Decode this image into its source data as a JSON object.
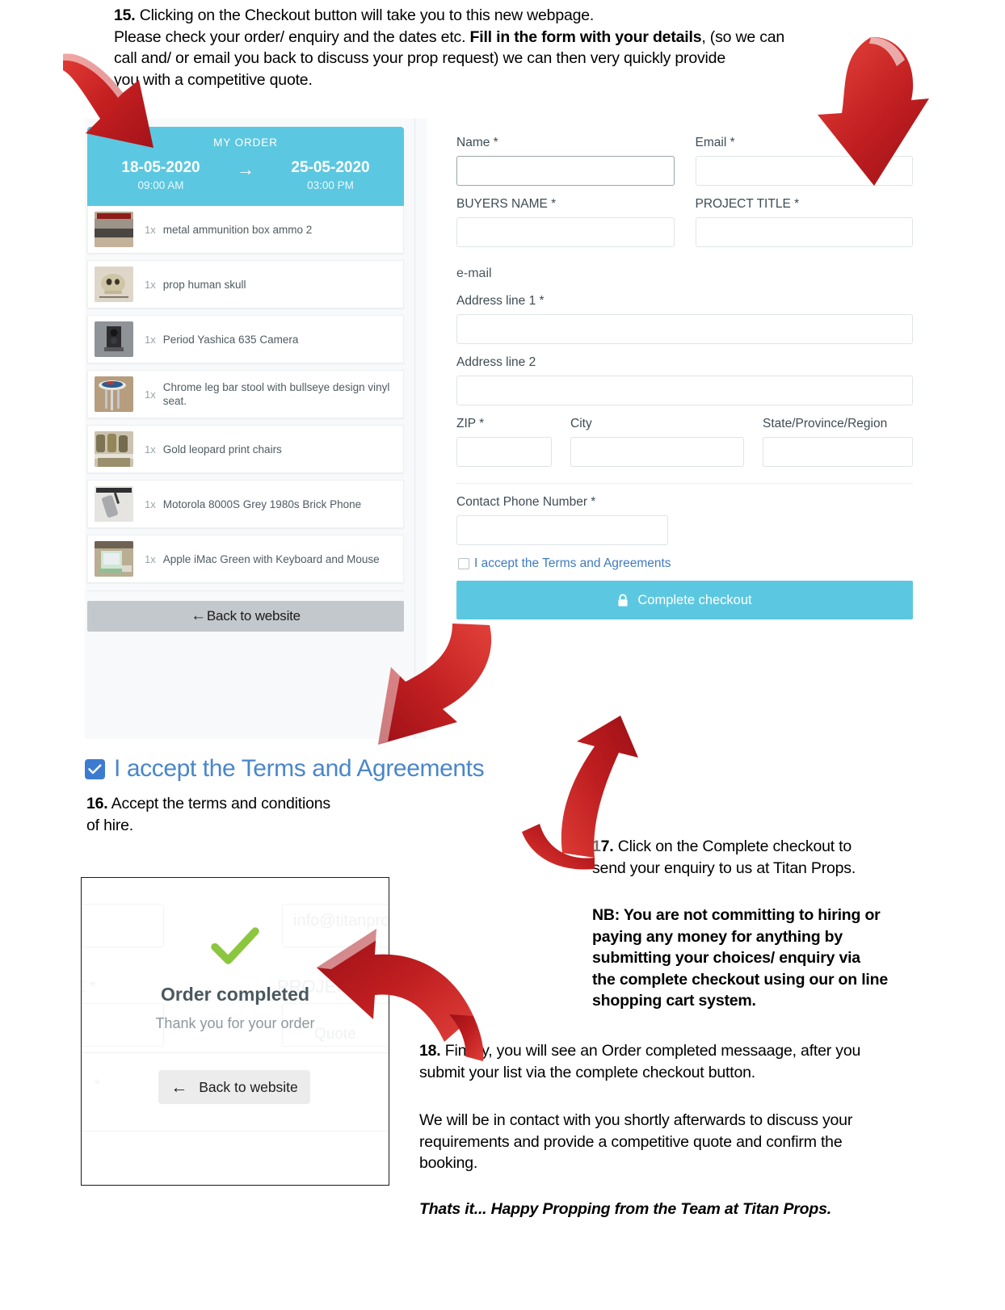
{
  "top_instructions": {
    "line1_num": "15.",
    "line1": " Clicking on the Checkout button will take you to this new webpage.",
    "line2a": "Please check your order/ enquiry and the dates etc. ",
    "line2b": "Fill in the form with your details",
    "line2c": ", (so we can",
    "line3": " call and/ or email you back to discuss your prop request) we can then very quickly provide",
    "line4": "you with a competitive quote."
  },
  "cart": {
    "title": "MY ORDER",
    "start_date": "18-05-2020",
    "start_time": "09:00 AM",
    "arrow": "→",
    "end_date": "25-05-2020",
    "end_time": "03:00 PM",
    "items": [
      {
        "qty": "1x",
        "name": "metal ammunition box ammo 2",
        "thumb": "ammo-box-thumbnail"
      },
      {
        "qty": "1x",
        "name": "prop human skull",
        "thumb": "skull-thumbnail"
      },
      {
        "qty": "1x",
        "name": "Period Yashica 635 Camera",
        "thumb": "camera-thumbnail"
      },
      {
        "qty": "1x",
        "name": "Chrome leg bar stool with bullseye design vinyl seat.",
        "thumb": "bar-stool-thumbnail"
      },
      {
        "qty": "1x",
        "name": "Gold leopard print chairs",
        "thumb": "chairs-thumbnail"
      },
      {
        "qty": "1x",
        "name": "Motorola 8000S Grey 1980s Brick Phone",
        "thumb": "brick-phone-thumbnail"
      },
      {
        "qty": "1x",
        "name": "Apple iMac Green with Keyboard and Mouse",
        "thumb": "imac-thumbnail"
      }
    ],
    "back_arrow": "←",
    "back_label": "Back to website"
  },
  "form": {
    "name_label": "Name *",
    "name_value": "",
    "email_label": "Email *",
    "email_value": "",
    "buyers_name_label": "BUYERS NAME *",
    "buyers_name_value": "",
    "project_title_label": "PROJECT TITLE *",
    "project_title_value": "",
    "email_note": "e-mail",
    "address1_label": "Address line 1 *",
    "address1_value": "",
    "address2_label": "Address line 2",
    "address2_value": "",
    "zip_label": "ZIP *",
    "zip_value": "",
    "city_label": "City",
    "city_value": "",
    "state_label": "State/Province/Region",
    "state_value": "",
    "phone_label": "Contact Phone Number *",
    "phone_value": "",
    "terms_label": "I accept the Terms and Agreements",
    "terms_checked": false,
    "checkout_label": "Complete checkout",
    "checkout_icon": "lock-icon"
  },
  "accept_callout": {
    "label": "I accept the Terms and Agreements",
    "checked": true,
    "checkbox_color": "#3d7bd1",
    "text_color": "#4a86c9"
  },
  "step16": {
    "num": "16.",
    "line1": " Accept the terms and conditions",
    "line2": "of hire."
  },
  "step17": {
    "num": "17.",
    "line1": " Click on the Complete checkout to",
    "line2": "send your enquiry to us at Titan Props."
  },
  "nb": {
    "line1": "NB: You are not committing to hiring or",
    "line2": "paying any money for anything by",
    "line3": "submitting your choices/ enquiry via",
    "line4": "the complete checkout using our on line",
    "line5": "shopping cart system."
  },
  "step18": {
    "num": "18.",
    "line1": " Finally, you will see an Order completed messaage, after you",
    "line2": "submit your list via the complete checkout button."
  },
  "closing": {
    "line1": "We will be in contact with you shortly afterwards to discuss your",
    "line2": "requirements and provide a competitive quote and confirm the",
    "line3": "booking."
  },
  "signoff": {
    "text": "Thats it... Happy Propping from the Team at Titan Props."
  },
  "order_completed": {
    "check_icon": "green-check-icon",
    "check_color": "#8CC63F",
    "title": "Order completed",
    "subtitle": "Thank you for your order",
    "back_arrow": "←",
    "back_label": "Back to website",
    "ghost_email": "info@titanprop",
    "ghost_project": "PROJECT TI",
    "ghost_quote": "Quote",
    "ghost_name_frag": "E *",
    "ghost_star": "*"
  },
  "theme": {
    "teal": "#5cc7e0",
    "arrow_red": "#cf2027",
    "cart_bg": "#f7f9fa",
    "back_btn_grey": "#c3c8cd"
  }
}
